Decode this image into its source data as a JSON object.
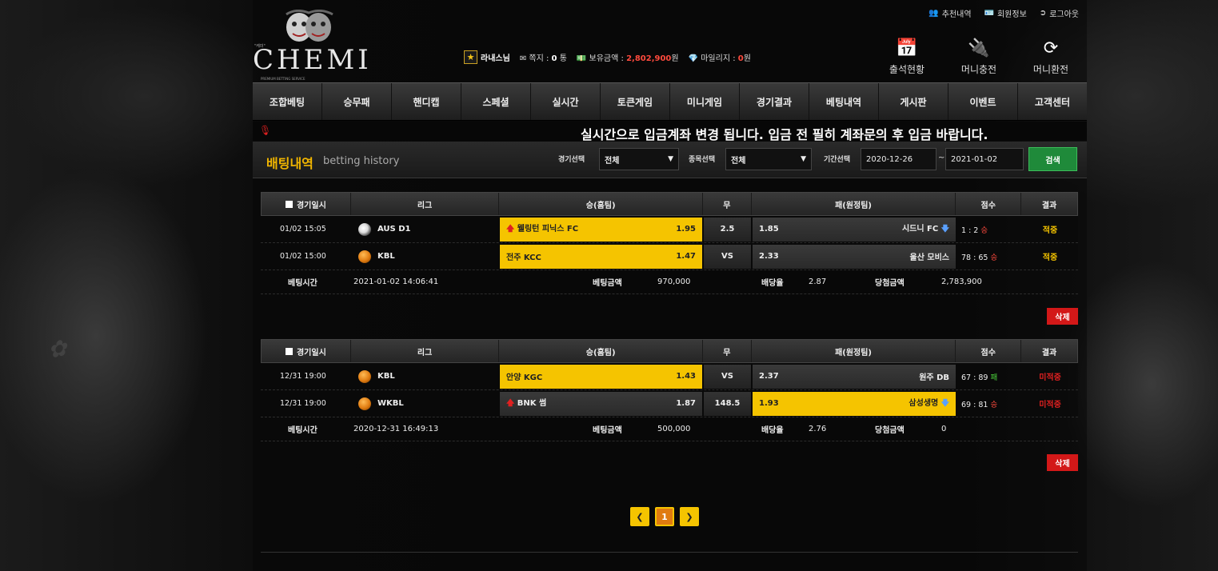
{
  "brand": {
    "name": "CHEMI",
    "small_text": "\"케미\"",
    "tag": "PREMIUM BETTING SERVICE"
  },
  "toplinks": [
    {
      "icon": "users-icon",
      "label": "추천내역"
    },
    {
      "icon": "id-card-icon",
      "label": "회원정보"
    },
    {
      "icon": "logout-icon",
      "label": "로그아웃"
    }
  ],
  "user": {
    "name": "라내스님",
    "message_label": "쪽지 : ",
    "message_count": "0",
    "message_unit": "통",
    "balance_label": "보유금액 : ",
    "balance_value": "2,802,900",
    "balance_unit": "원",
    "mileage_label": "마일리지 : ",
    "mileage_value": "0",
    "mileage_unit": "원"
  },
  "quick": [
    {
      "icon": "calendar-icon",
      "label": "출석현황"
    },
    {
      "icon": "plug-icon",
      "label": "머니충전"
    },
    {
      "icon": "refresh-icon",
      "label": "머니환전"
    }
  ],
  "nav": [
    "조합베팅",
    "승무패",
    "핸디캡",
    "스페셜",
    "실시간",
    "토큰게임",
    "미니게임",
    "경기결과",
    "베팅내역",
    "게시판",
    "이벤트",
    "고객센터"
  ],
  "notice": "실시간으로 입금계좌 변경 됩니다.  입금 전 필히 계좌문의 후 입금 바랍니다.",
  "page": {
    "title": "배팅내역",
    "subtitle": "betting history",
    "game_select_label": "경기선택",
    "game_select_value": "전체",
    "sport_select_label": "종목선택",
    "sport_select_value": "전체",
    "period_label": "기간선택",
    "date_from": "2020-12-26",
    "date_sep": "~",
    "date_to": "2021-01-02",
    "search_label": "검색"
  },
  "table_headers": [
    "경기일시",
    "리그",
    "승(홈팀)",
    "무",
    "패(원정팀)",
    "점수",
    "결과"
  ],
  "summary_labels": {
    "bet_time": "베팅시간",
    "bet_amount": "베팅금액",
    "odds": "배당율",
    "win_amount": "당첨금액"
  },
  "delete_label": "삭제",
  "bets": [
    {
      "rows": [
        {
          "date": "01/02 15:05",
          "league": "AUS D1",
          "sport": "soccer",
          "home": "웰링턴 피닉스 FC",
          "home_odds": "1.95",
          "home_arrow": "up",
          "draw": "2.5",
          "away_odds": "1.85",
          "away": "시드니 FC",
          "away_arrow": "down",
          "score": "1 : 2",
          "score_mark": "승",
          "result": "적중",
          "pick": "none"
        },
        {
          "date": "01/02 15:00",
          "league": "KBL",
          "sport": "basketball",
          "home": "전주 KCC",
          "home_odds": "1.47",
          "home_arrow": "",
          "draw": "VS",
          "away_odds": "2.33",
          "away": "울산 모비스",
          "away_arrow": "",
          "score": "78 : 65",
          "score_mark": "승",
          "result": "적중",
          "pick": "home"
        }
      ],
      "bet_time": "2021-01-02 14:06:41",
      "bet_amount": "970,000",
      "odds": "2.87",
      "win_amount": "2,783,900"
    },
    {
      "rows": [
        {
          "date": "12/31 19:00",
          "league": "KBL",
          "sport": "basketball",
          "home": "안양 KGC",
          "home_odds": "1.43",
          "home_arrow": "",
          "draw": "VS",
          "away_odds": "2.37",
          "away": "원주 DB",
          "away_arrow": "",
          "score": "67 : 89",
          "score_mark": "패",
          "result": "미적중",
          "pick": "home"
        },
        {
          "date": "12/31 19:00",
          "league": "WKBL",
          "sport": "basketball",
          "home": "BNK 썸",
          "home_odds": "1.87",
          "home_arrow": "up",
          "draw": "148.5",
          "away_odds": "1.93",
          "away": "삼성생명",
          "away_arrow": "down",
          "score": "69 : 81",
          "score_mark": "승",
          "result": "미적중",
          "pick": "away"
        }
      ],
      "bet_time": "2020-12-31 16:49:13",
      "bet_amount": "500,000",
      "odds": "2.76",
      "win_amount": "0"
    }
  ],
  "pagination": {
    "current": "1"
  },
  "colors": {
    "accent": "#f5c400",
    "hit": "#f5c400",
    "miss": "#e02020",
    "search": "#1f8a3a",
    "delete": "#d31818"
  }
}
